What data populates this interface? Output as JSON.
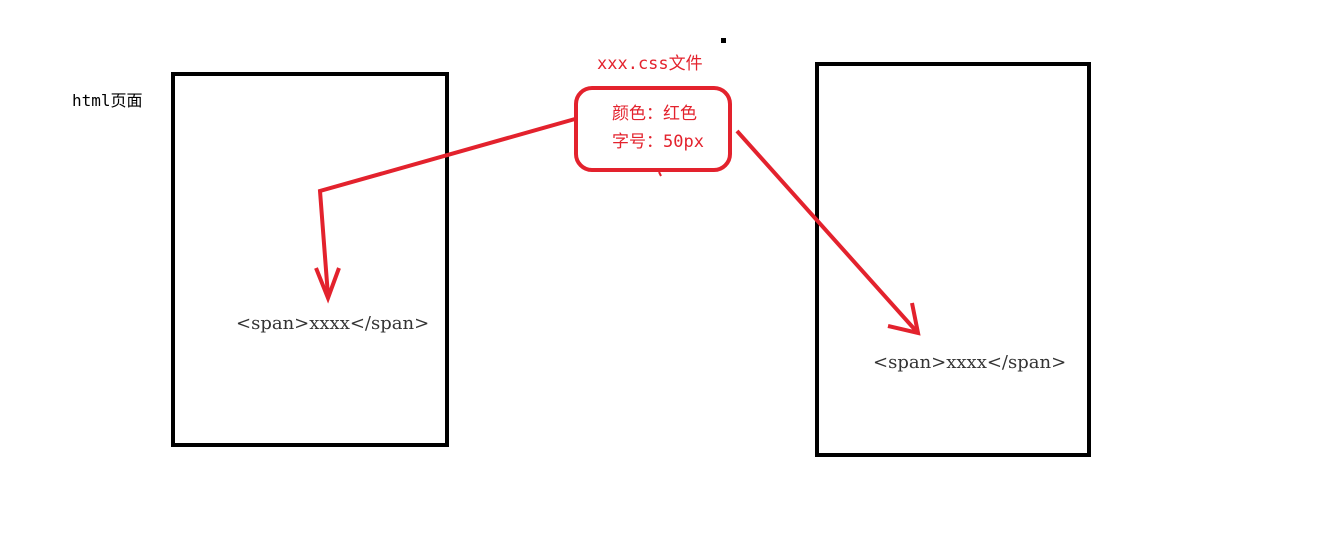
{
  "html_page_label": "html页面",
  "css_file": {
    "title": "xxx.css文件",
    "rules": [
      "颜色：红色",
      "字号：50px"
    ]
  },
  "left_page": {
    "element_text": "<span>xxxx</span>"
  },
  "right_page": {
    "element_text": "<span>xxxx</span>"
  },
  "colors": {
    "accent": "#e3222d",
    "border": "#000000",
    "text": "#333333"
  }
}
